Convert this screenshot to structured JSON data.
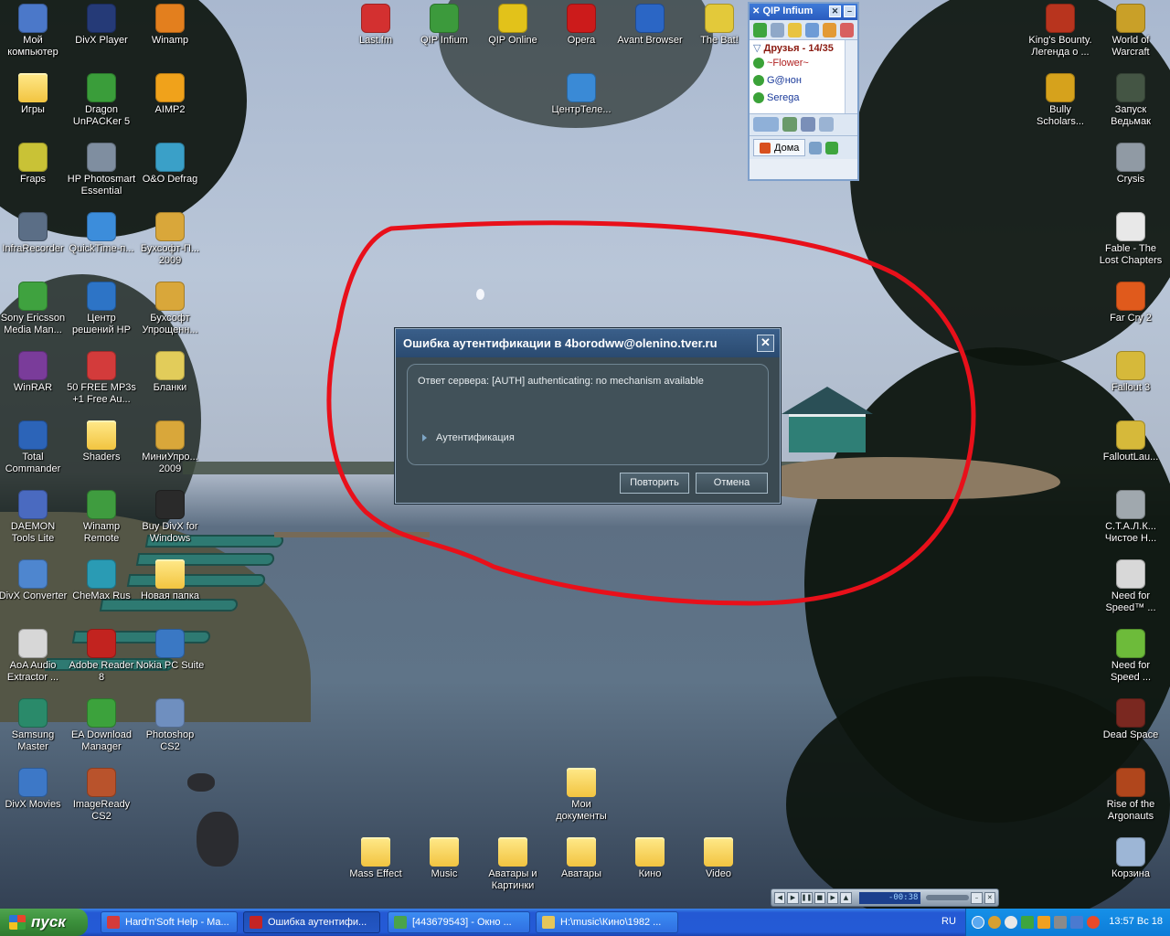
{
  "desktop": {
    "icons_left": [
      {
        "label": "Мой компьютер",
        "icon": "computer-icon",
        "color": "#4b78c9"
      },
      {
        "label": "DivX Player",
        "icon": "divx-player-icon",
        "color": "#253a77"
      },
      {
        "label": "Winamp",
        "icon": "winamp-icon",
        "color": "#e37f1e"
      },
      {
        "label": "Игры",
        "icon": "folder-icon",
        "color": "folder"
      },
      {
        "label": "Dragon UnPACKer 5",
        "icon": "dragon-icon",
        "color": "#3a9d3a"
      },
      {
        "label": "AIMP2",
        "icon": "aimp-icon",
        "color": "#f0a21b"
      },
      {
        "label": "Fraps",
        "icon": "fraps-icon",
        "color": "#c9c236"
      },
      {
        "label": "HP Photosmart Essential",
        "icon": "hp-photosmart-icon",
        "color": "#7f8ea0"
      },
      {
        "label": "O&O Defrag",
        "icon": "defrag-icon",
        "color": "#3aa0c8"
      },
      {
        "label": "InfraRecorder",
        "icon": "infrarecorder-icon",
        "color": "#5b6e86"
      },
      {
        "label": "QuickTime-п...",
        "icon": "quicktime-icon",
        "color": "#3c8ddb"
      },
      {
        "label": "Бухсофт-П... 2009",
        "icon": "buhsoft-icon",
        "color": "#d9a73a"
      },
      {
        "label": "Sony Ericsson Media Man...",
        "icon": "sony-ericsson-icon",
        "color": "#3fa23f"
      },
      {
        "label": "Центр решений HP",
        "icon": "hp-center-icon",
        "color": "#2d74c6"
      },
      {
        "label": "Бухсофт Упрощенн...",
        "icon": "buhsoft-icon",
        "color": "#d9a73a"
      },
      {
        "label": "WinRAR",
        "icon": "winrar-icon",
        "color": "#7a3c9a"
      },
      {
        "label": "50 FREE MP3s +1 Free Au...",
        "icon": "mp3-icon",
        "color": "#d33b3b"
      },
      {
        "label": "Бланки",
        "icon": "blanks-icon",
        "color": "#e2cc5a"
      },
      {
        "label": "Total Commander",
        "icon": "total-commander-icon",
        "color": "#2c64b8"
      },
      {
        "label": "Shaders",
        "icon": "folder-icon",
        "color": "folder"
      },
      {
        "label": "МиниУпро... 2009",
        "icon": "buhsoft-icon",
        "color": "#d9a73a"
      },
      {
        "label": "DAEMON Tools Lite",
        "icon": "daemon-tools-icon",
        "color": "#4a6ac0"
      },
      {
        "label": "Winamp Remote",
        "icon": "winamp-remote-icon",
        "color": "#3f9c3f"
      },
      {
        "label": "Buy DivX for Windows",
        "icon": "divx-buy-icon",
        "color": "#2a2a2a"
      },
      {
        "label": "DivX Converter",
        "icon": "divx-converter-icon",
        "color": "#4e86cf"
      },
      {
        "label": "CheMax Rus",
        "icon": "chemax-icon",
        "color": "#2a9bb4"
      },
      {
        "label": "Новая папка",
        "icon": "folder-icon",
        "color": "folder"
      },
      {
        "label": "AoA Audio Extractor ...",
        "icon": "aoa-icon",
        "color": "#d7d7d7"
      },
      {
        "label": "Adobe Reader 8",
        "icon": "adobe-reader-icon",
        "color": "#c2231f"
      },
      {
        "label": "Nokia PC Suite",
        "icon": "nokia-icon",
        "color": "#3a78c4"
      },
      {
        "label": "Samsung Master",
        "icon": "samsung-icon",
        "color": "#2a8a6a"
      },
      {
        "label": "EA Download Manager",
        "icon": "ea-icon",
        "color": "#3ca23c"
      },
      {
        "label": "Photoshop CS2",
        "icon": "photoshop-icon",
        "color": "#6f8fbf"
      },
      {
        "label": "DivX Movies",
        "icon": "divx-movies-icon",
        "color": "#3d78c7"
      },
      {
        "label": "ImageReady CS2",
        "icon": "imageready-icon",
        "color": "#b9532c"
      }
    ],
    "icons_top": [
      {
        "label": "Last.fm",
        "icon": "lastfm-icon",
        "color": "#d33030"
      },
      {
        "label": "QIP Infium",
        "icon": "qip-infium-icon",
        "color": "#3c9a3c"
      },
      {
        "label": "QIP Online",
        "icon": "qip-online-icon",
        "color": "#e2c21a"
      },
      {
        "label": "Opera",
        "icon": "opera-icon",
        "color": "#cc1b1b"
      },
      {
        "label": "Avant Browser",
        "icon": "avant-icon",
        "color": "#2b66c5"
      },
      {
        "label": "The Bat!",
        "icon": "thebat-icon",
        "color": "#e3c93a"
      },
      {
        "label": "ЦентрТеле...",
        "icon": "telecenter-icon",
        "color": "#3a8ad6"
      }
    ],
    "icons_right": [
      {
        "label": "King's Bounty. Легенда о ...",
        "icon": "kings-bounty-icon",
        "color": "#b8341e"
      },
      {
        "label": "World of Warcraft",
        "icon": "wow-icon",
        "color": "#c9a028"
      },
      {
        "label": "Bully Scholars...",
        "icon": "bully-icon",
        "color": "#d6a21c"
      },
      {
        "label": "Запуск Ведьмак",
        "icon": "witcher-icon",
        "color": "#445544"
      },
      {
        "label": "Crysis",
        "icon": "crysis-icon",
        "color": "#909aa4"
      },
      {
        "label": "Fable - The Lost Chapters",
        "icon": "fable-icon",
        "color": "#e8e8e8"
      },
      {
        "label": "Far Cry 2",
        "icon": "farcry-icon",
        "color": "#e05a1c"
      },
      {
        "label": "Fallout 3",
        "icon": "fallout-icon",
        "color": "#d6b93a"
      },
      {
        "label": "FalloutLau...",
        "icon": "fallout-launcher-icon",
        "color": "#d6b93a"
      },
      {
        "label": "С.Т.А.Л.К... Чистое Н...",
        "icon": "stalker-icon",
        "color": "#a0a8ae"
      },
      {
        "label": "Need for Speed™ ...",
        "icon": "nfs-icon",
        "color": "#d8d8d8"
      },
      {
        "label": "Need for Speed ...",
        "icon": "nfs-spore-icon",
        "color": "#6dbb3a"
      },
      {
        "label": "Dead Space",
        "icon": "dead-space-icon",
        "color": "#7a2820"
      },
      {
        "label": "Rise of the Argonauts",
        "icon": "argonauts-icon",
        "color": "#b0461c"
      },
      {
        "label": "Корзина",
        "icon": "recycle-bin-icon",
        "color": "#9db6d6"
      }
    ],
    "icons_bottom": [
      {
        "label": "Мои документы",
        "icon": "my-documents-icon",
        "color": "folder"
      },
      {
        "label": "Mass Effect",
        "icon": "folder-icon",
        "color": "folder"
      },
      {
        "label": "Music",
        "icon": "folder-icon",
        "color": "folder"
      },
      {
        "label": "Аватары и Картинки",
        "icon": "folder-icon",
        "color": "folder"
      },
      {
        "label": "Аватары",
        "icon": "folder-icon",
        "color": "folder"
      },
      {
        "label": "Кино",
        "icon": "folder-icon",
        "color": "folder"
      },
      {
        "label": "Video",
        "icon": "folder-icon",
        "color": "folder"
      }
    ]
  },
  "dialog": {
    "title": "Ошибка аутентификации в 4borodww@olenino.tver.ru",
    "message": "Ответ сервера: [AUTH] authenticating: no mechanism available",
    "auth_label": "Аутентификация",
    "retry_label": "Повторить",
    "cancel_label": "Отмена",
    "close_glyph": "✕"
  },
  "qip": {
    "title": "QIP Infium",
    "group": "Друзья - 14/35",
    "contacts": [
      "~Flower~",
      "G@нон",
      "Serega"
    ],
    "status_label": "Дома"
  },
  "player": {
    "time": "-00:38"
  },
  "taskbar": {
    "start_label": "пуск",
    "tasks": [
      {
        "label": "Hard'n'Soft Help - Ma...",
        "icon_color": "#d33b3b"
      },
      {
        "label": "Ошибка аутентифи...",
        "icon_color": "#c42424"
      },
      {
        "label": "[443679543] - Окно ...",
        "icon_color": "#4aa34a"
      },
      {
        "label": "H:\\music\\Кино\\1982 ...",
        "icon_color": "#e6c65a"
      }
    ],
    "language": "RU",
    "clock": "13:57 Вс 18"
  },
  "colors": {
    "marker": "#e8101a"
  }
}
